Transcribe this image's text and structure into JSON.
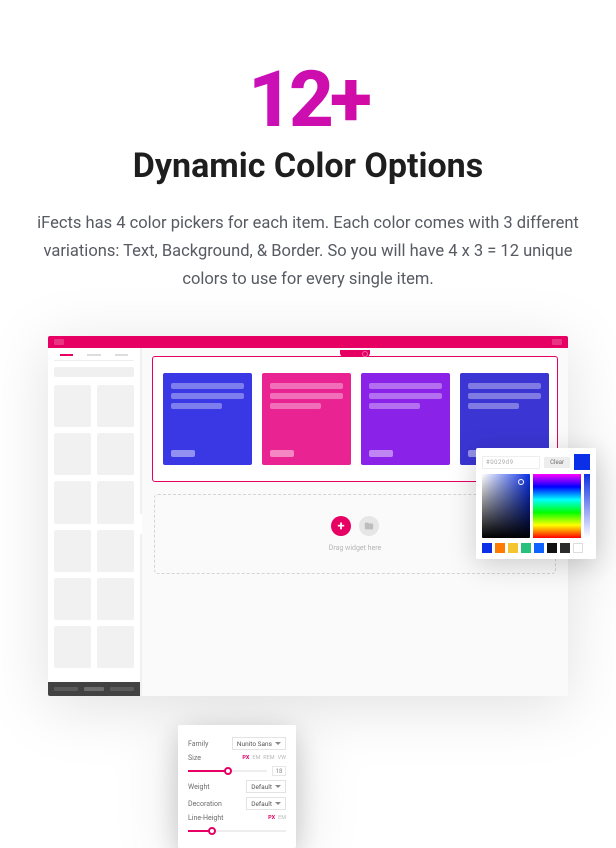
{
  "hero": {
    "number": "12+",
    "title": "Dynamic Color Options",
    "description": "iFects has 4 color pickers for each item. Each color comes with 3 different variations: Text, Background, & Border. So you will have 4 x 3 = 12 unique colors to use for every single item."
  },
  "dropzone": {
    "add_icon": "+",
    "hint": "Drag widget here"
  },
  "color_picker": {
    "hex_value": "#0029d9",
    "clear_label": "Clear",
    "swatches": [
      "#0a2fe6",
      "#ff7a00",
      "#f4c531",
      "#27c07d",
      "#0d63ff",
      "#111111",
      "#2b2b2b",
      "#ffffff"
    ]
  },
  "typography": {
    "labels": {
      "family": "Family",
      "size": "Size",
      "weight": "Weight",
      "decoration": "Decoration",
      "line_height": "Line-Height"
    },
    "family_value": "Nunito Sans",
    "weight_value": "Default",
    "decoration_value": "Default",
    "size_value": "18",
    "units": {
      "px": "PX",
      "em": "EM",
      "rem": "REM",
      "vw": "VW"
    }
  }
}
